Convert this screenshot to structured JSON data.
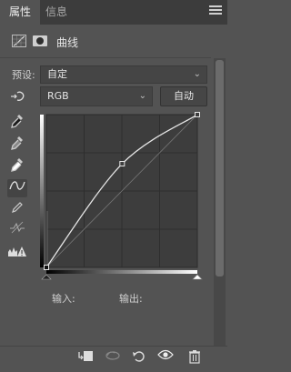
{
  "tabs": [
    {
      "label": "属性"
    },
    {
      "label": "信息"
    }
  ],
  "header": {
    "title": "曲线"
  },
  "preset": {
    "label": "预设:",
    "value": "自定"
  },
  "channel": {
    "value": "RGB",
    "auto_label": "自动"
  },
  "io": {
    "input_label": "输入:",
    "output_label": "输出:"
  },
  "curve": {
    "points": [
      [
        0,
        0
      ],
      [
        128,
        173
      ],
      [
        255,
        255
      ]
    ],
    "range": [
      0,
      255
    ]
  },
  "icons": {
    "tools": [
      "hand-target-icon",
      "black-eyedropper-icon",
      "gray-eyedropper-icon",
      "white-eyedropper-icon",
      "curve-points-icon",
      "pencil-icon",
      "smooth-icon",
      "clipping-warning-icon"
    ],
    "bottom": [
      "clip-to-layer-icon",
      "view-previous-icon",
      "reset-icon",
      "visibility-eye-icon",
      "delete-icon"
    ]
  },
  "colors": {
    "panel": "#535353",
    "curve": "#e6e6e6",
    "graph_bg": "#3d3d3d"
  }
}
